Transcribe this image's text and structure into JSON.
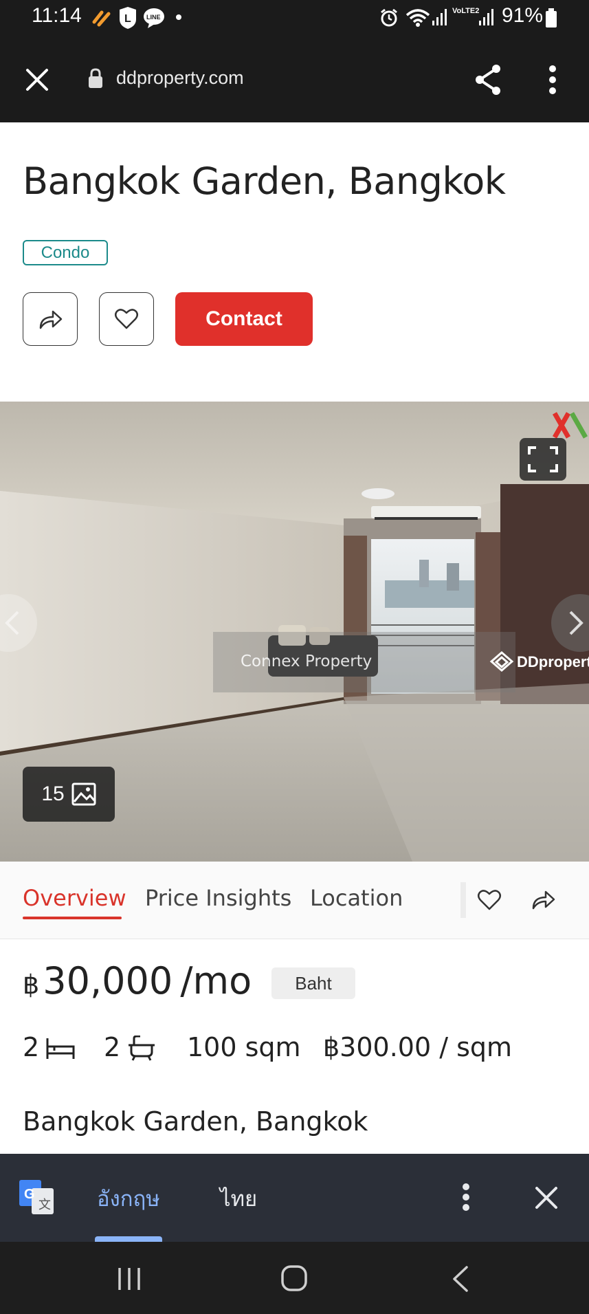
{
  "status_bar": {
    "time": "11:14",
    "battery": "91%",
    "icons": [
      "notification-icon",
      "line-l-icon",
      "line-chat-icon",
      "dot-icon",
      "alarm-icon",
      "wifi-icon",
      "signal-icon",
      "volte-icon",
      "signal-icon",
      "battery-icon"
    ],
    "lte_label": "VoLTE2"
  },
  "browser": {
    "url": "ddproperty.com",
    "icons": [
      "close-icon",
      "lock-icon",
      "share-icon",
      "more-vert-icon"
    ]
  },
  "listing": {
    "title": "Bangkok Garden, Bangkok",
    "property_type": "Condo",
    "contact_label": "Contact",
    "photo_count": "15",
    "watermark_center": "Connex Property",
    "watermark_right": "DDproperty"
  },
  "tabs": [
    {
      "label": "Overview",
      "active": true
    },
    {
      "label": "Price Insights",
      "active": false
    },
    {
      "label": "Location",
      "active": false
    }
  ],
  "price": {
    "symbol": "฿",
    "amount": "30,000",
    "period": "/mo",
    "currency_chip": "Baht"
  },
  "specs": {
    "bedrooms": "2",
    "bathrooms": "2",
    "area": "100 sqm",
    "price_per_sqm": "฿300.00 / sqm"
  },
  "address": "Bangkok Garden, Bangkok",
  "translate_bar": {
    "lang_source": "อังกฤษ",
    "lang_target": "ไทย"
  },
  "colors": {
    "accent": "#e0302b",
    "teal": "#1b8a8a",
    "dark_bar": "#1b1b1b",
    "translate_bg": "#2b2f38"
  }
}
